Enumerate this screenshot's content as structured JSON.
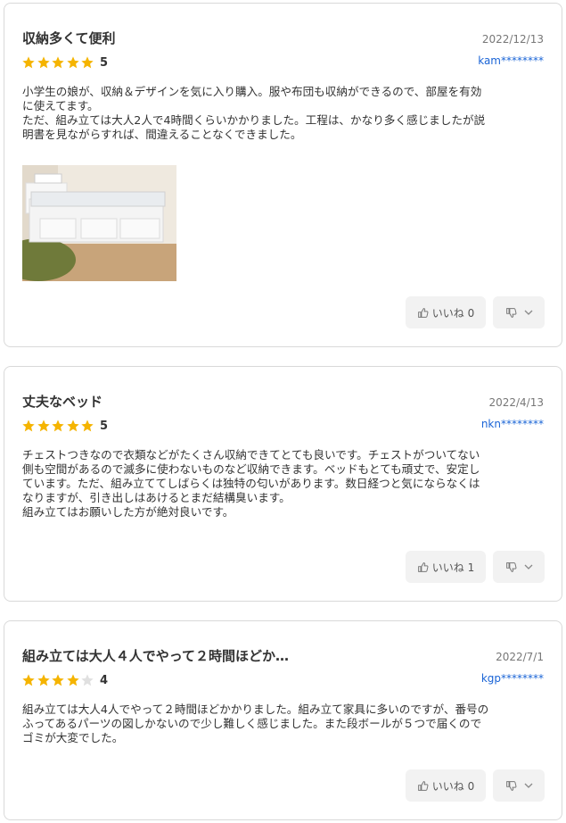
{
  "reviews": [
    {
      "title": "収納多くて便利",
      "date": "2022/12/13",
      "user": "kam********",
      "rating": 5,
      "rating_label": "5",
      "text": "小学生の娘が、収納＆デザインを気に入り購入。服や布団も収納ができるので、部屋を有効\nに使えてます。\nただ、組み立ては大人2人で4時間くらいかかりました。工程は、かなり多く感じましたが説\n明書を見ながらすれば、間違えることなくできました。",
      "like_label": "いいね 0",
      "has_photo": true
    },
    {
      "title": "丈夫なベッド",
      "date": "2022/4/13",
      "user": "nkn********",
      "rating": 5,
      "rating_label": "5",
      "text": "チェストつきなので衣類などがたくさん収納できてとても良いです。チェストがついてない\n側も空間があるので滅多に使わないものなど収納できます。ベッドもとても頑丈で、安定し\nています。ただ、組み立ててしばらくは独特の匂いがあります。数日経つと気にならなくは\nなりますが、引き出しはあけるとまだ結構臭います。\n組み立てはお願いした方が絶対良いです。",
      "like_label": "いいね 1",
      "has_photo": false
    },
    {
      "title": "組み立ては大人４人でやって２時間ほどか…",
      "date": "2022/7/1",
      "user": "kgp********",
      "rating": 4,
      "rating_label": "4",
      "text": "組み立ては大人4人でやって２時間ほどかかりました。組み立て家具に多いのですが、番号の\nふってあるパーツの図しかないので少し難しく感じました。また段ボールが５つで届くので\nゴミが大変でした。",
      "like_label": "いいね 0",
      "has_photo": false
    }
  ],
  "colors": {
    "star_filled": "#f5b400",
    "star_empty": "#e0e0e0",
    "user_link": "#1a64d6"
  },
  "icons": {
    "like": "thumbs-up-icon",
    "dislike": "thumbs-down-icon",
    "dropdown": "chevron-down-icon"
  }
}
